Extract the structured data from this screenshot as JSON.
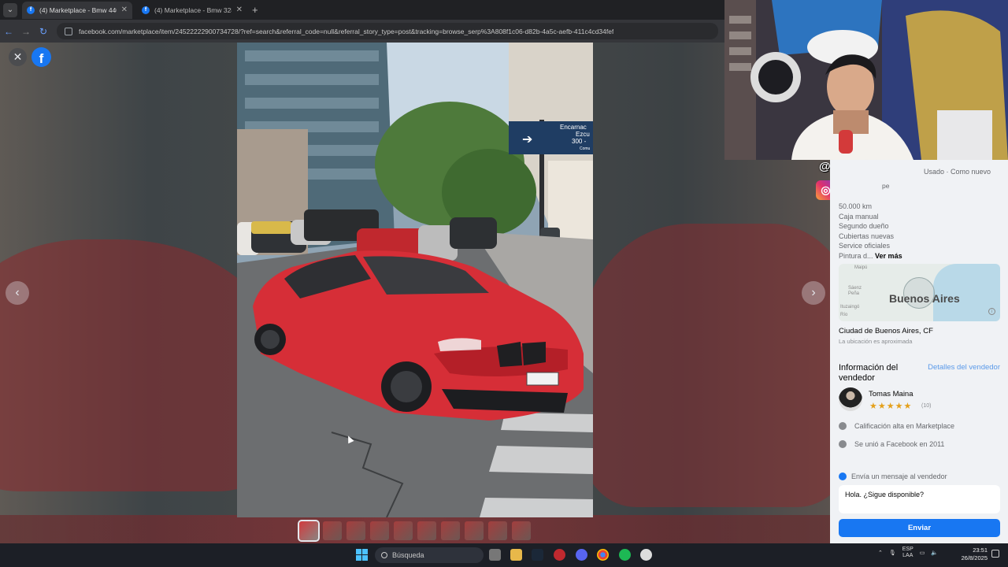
{
  "browser": {
    "tabs": [
      {
        "title": "(4) Marketplace - Bmw 440i Co",
        "active": true
      },
      {
        "title": "(4) Marketplace - Bmw 328 pa",
        "active": false
      }
    ],
    "new_tab": "+",
    "url": "facebook.com/marketplace/item/24522222900734728/?ref=search&referral_code=null&referral_story_type=post&tracking=browse_serp%3A808f1c06-d82b-4a5c-aefb-411c4cd34fef"
  },
  "viewer": {
    "close_glyph": "✕",
    "logo_letter": "f",
    "prev_glyph": "‹",
    "next_glyph": "›",
    "street_sign_line1": "Encarnac",
    "street_sign_line2": "Ezcu",
    "street_sign_line3": "300 -",
    "street_sign_line4": "Comu",
    "thumbnail_count": 10
  },
  "overlay": {
    "handle": "@barcatini",
    "socials": [
      "instagram-icon",
      "tiktok-icon",
      "facebook-icon"
    ],
    "social_glyphs": [
      "◎",
      "♪",
      "f"
    ]
  },
  "listing": {
    "condition": "Usado · Como nuevo",
    "subtitle": "pe",
    "description": [
      "50.000 km",
      "Caja manual",
      "Segundo dueño",
      "Cubiertas nuevas",
      "Service oficiales"
    ],
    "desc_last": "Pintura d...",
    "see_more": "Ver más",
    "map": {
      "city": "Buenos Aires",
      "labels": [
        "Maipú",
        "Sáenz Peña",
        "Ituzaingó",
        "Río"
      ],
      "info": "i"
    },
    "location": "Ciudad de Buenos Aires, CF",
    "location_note": "La ubicación es aproximada"
  },
  "seller": {
    "heading": "Información del vendedor",
    "details_link": "Detalles del vendedor",
    "name": "Tomas Maina",
    "stars": "★★★★★",
    "rating_count": "(10)",
    "rating": 4.5,
    "badge": "Calificación alta en Marketplace",
    "joined": "Se unió a Facebook en 2011"
  },
  "message": {
    "heading": "Envía un mensaje al vendedor",
    "text": "Hola. ¿Sigue disponible?",
    "send": "Enviar"
  },
  "taskbar": {
    "search": "Búsqueda",
    "lang_top": "ESP",
    "lang_bottom": "LAA",
    "time": "23:51",
    "date": "26/8/2025"
  },
  "colors": {
    "accent": "#1877f2",
    "car": "#d62e37",
    "panel": "#f0f2f5"
  }
}
